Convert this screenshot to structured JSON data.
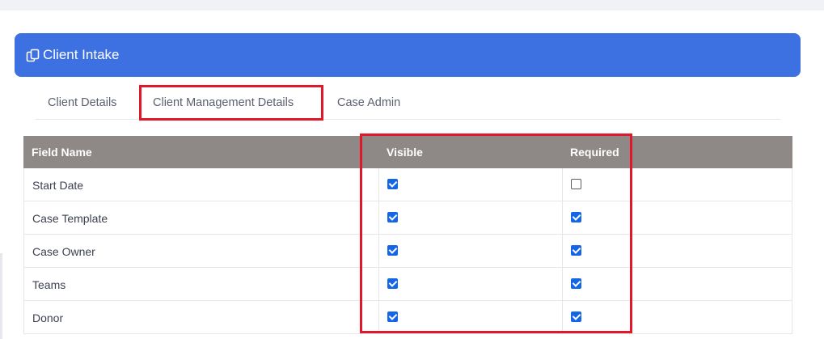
{
  "header": {
    "title": "Client Intake",
    "icon": "copy-icon"
  },
  "tabs": [
    {
      "label": "Client Details"
    },
    {
      "label": "Client Management Details"
    },
    {
      "label": "Case Admin"
    }
  ],
  "table": {
    "headers": {
      "field_name": "Field Name",
      "visible": "Visible",
      "required": "Required"
    },
    "rows": [
      {
        "name": "Start Date",
        "visible": true,
        "required": false
      },
      {
        "name": "Case Template",
        "visible": true,
        "required": true
      },
      {
        "name": "Case Owner",
        "visible": true,
        "required": true
      },
      {
        "name": "Teams",
        "visible": true,
        "required": true
      },
      {
        "name": "Donor",
        "visible": true,
        "required": true
      }
    ]
  },
  "colors": {
    "header_bg": "#3d70e1",
    "table_header_bg": "#8e8886",
    "highlight": "#e3172a",
    "checkbox": "#1466e6"
  }
}
